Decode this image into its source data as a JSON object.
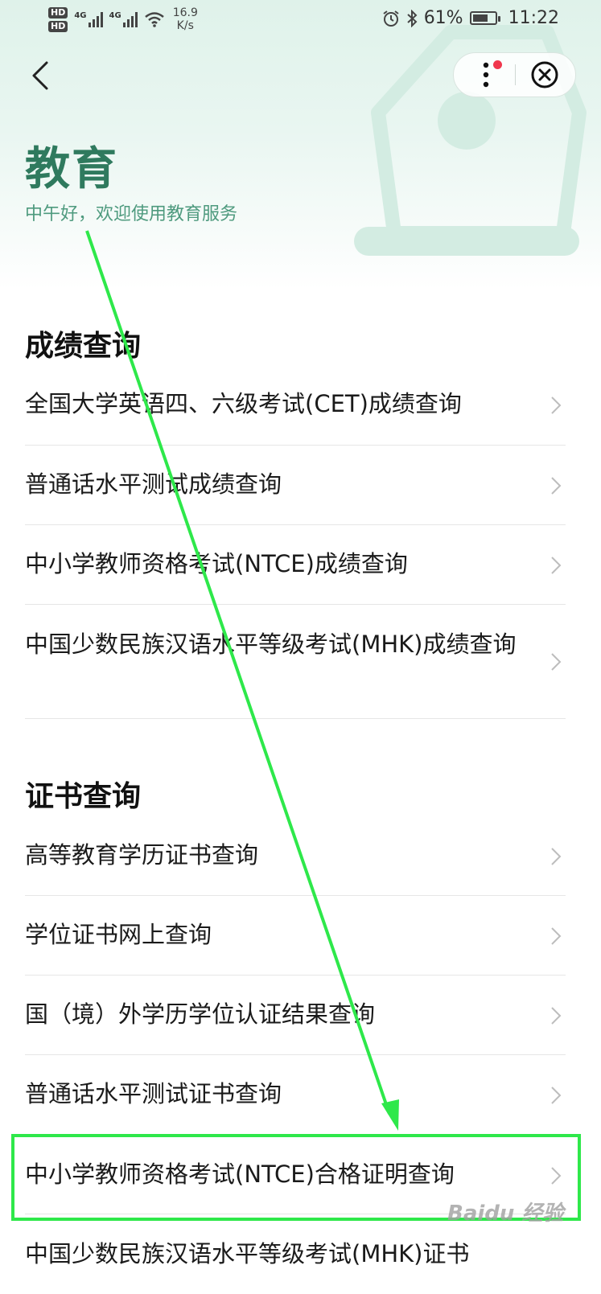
{
  "status_bar": {
    "hd1": "HD",
    "hd2": "HD",
    "net1": "4G",
    "net2": "4G",
    "speed_value": "16.9",
    "speed_unit": "K/s",
    "battery": "61%",
    "time": "11:22"
  },
  "header": {
    "title": "教育",
    "greeting": "中午好，欢迎使用教育服务"
  },
  "sections": [
    {
      "title": "成绩查询",
      "items": [
        "全国大学英语四、六级考试(CET)成绩查询",
        "普通话水平测试成绩查询",
        "中小学教师资格考试(NTCE)成绩查询",
        "中国少数民族汉语水平等级考试(MHK)成绩查询"
      ]
    },
    {
      "title": "证书查询",
      "items": [
        "高等教育学历证书查询",
        "学位证书网上查询",
        "国（境）外学历学位认证结果查询",
        "普通话水平测试证书查询",
        "中小学教师资格考试(NTCE)合格证明查询",
        "中国少数民族汉语水平等级考试(MHK)证书"
      ]
    }
  ],
  "watermark": "Baidu 经验",
  "colors": {
    "title": "#2f7a5e",
    "greeting": "#4e9a7e",
    "annotation": "#2ee84a",
    "badge": "#f0374d"
  }
}
